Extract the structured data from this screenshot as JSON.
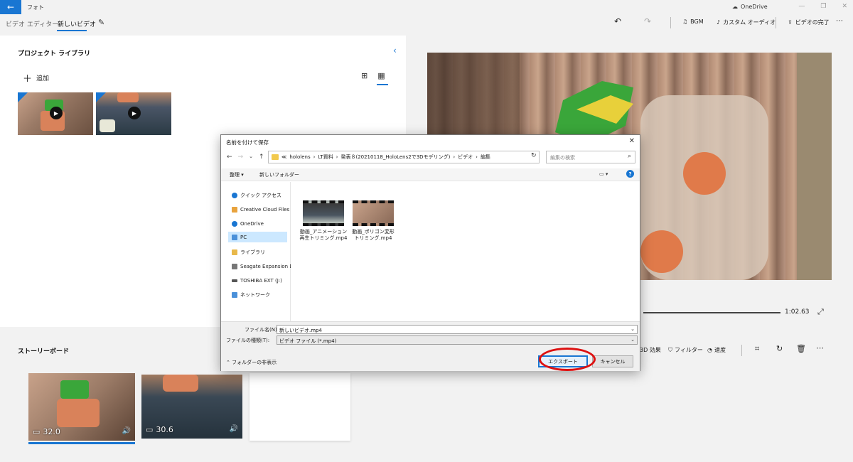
{
  "app": {
    "title": "フォト",
    "onedrive": "OneDrive"
  },
  "breadcrumb": {
    "root": "ビデオ エディター",
    "current": "新しいビデオ"
  },
  "toolbar": {
    "bgm": "BGM",
    "custom_audio": "カスタム オーディオ",
    "finish": "ビデオの完了"
  },
  "library": {
    "title": "プロジェクト ライブラリ",
    "add": "追加"
  },
  "preview": {
    "time": "1:02.63"
  },
  "storyboard": {
    "title": "ストーリーボード",
    "tools": {
      "effects": "3D 効果",
      "filters": "フィルター",
      "speed": "速度"
    },
    "clips": [
      {
        "duration": "32.0"
      },
      {
        "duration": "30.6"
      }
    ]
  },
  "dialog": {
    "title": "名前を付けて保存",
    "address": [
      "≪",
      "hololens",
      "LT資料",
      "発表８(20210118_HoloLens2で3Dモデリング)",
      "ビデオ",
      "編集"
    ],
    "search_placeholder": "編集の検索",
    "commands": {
      "organize": "整理 ▾",
      "new_folder": "新しいフォルダー"
    },
    "nav": [
      {
        "label": "クイック アクセス",
        "icon": "star-icon",
        "color": "#1976d2"
      },
      {
        "label": "Creative Cloud Files",
        "icon": "creative-cloud-icon",
        "color": "#e8a33d"
      },
      {
        "label": "OneDrive",
        "icon": "cloud-icon",
        "color": "#1976d2"
      },
      {
        "label": "PC",
        "icon": "pc-icon",
        "color": "#4a90d9"
      },
      {
        "label": "ライブラリ",
        "icon": "library-icon",
        "color": "#e8b84a"
      },
      {
        "label": "Seagate Expansion Dr",
        "icon": "drive-icon",
        "color": "#777777"
      },
      {
        "label": "TOSHIBA EXT (J:)",
        "icon": "drive-icon",
        "color": "#555555"
      },
      {
        "label": "ネットワーク",
        "icon": "network-icon",
        "color": "#4a90d9"
      }
    ],
    "files": [
      {
        "name_line1": "動画_アニメーション",
        "name_line2": "再生トリミング.mp4"
      },
      {
        "name_line1": "動画_ポリゴン変形",
        "name_line2": "トリミング.mp4"
      }
    ],
    "form": {
      "filename_label": "ファイル名(N):",
      "filename_value": "新しいビデオ.mp4",
      "filetype_label": "ファイルの種類(T):",
      "filetype_value": "ビデオ ファイル (*.mp4)",
      "hide_folders": "フォルダーの非表示",
      "export": "エクスポート",
      "cancel": "キャンセル"
    }
  }
}
